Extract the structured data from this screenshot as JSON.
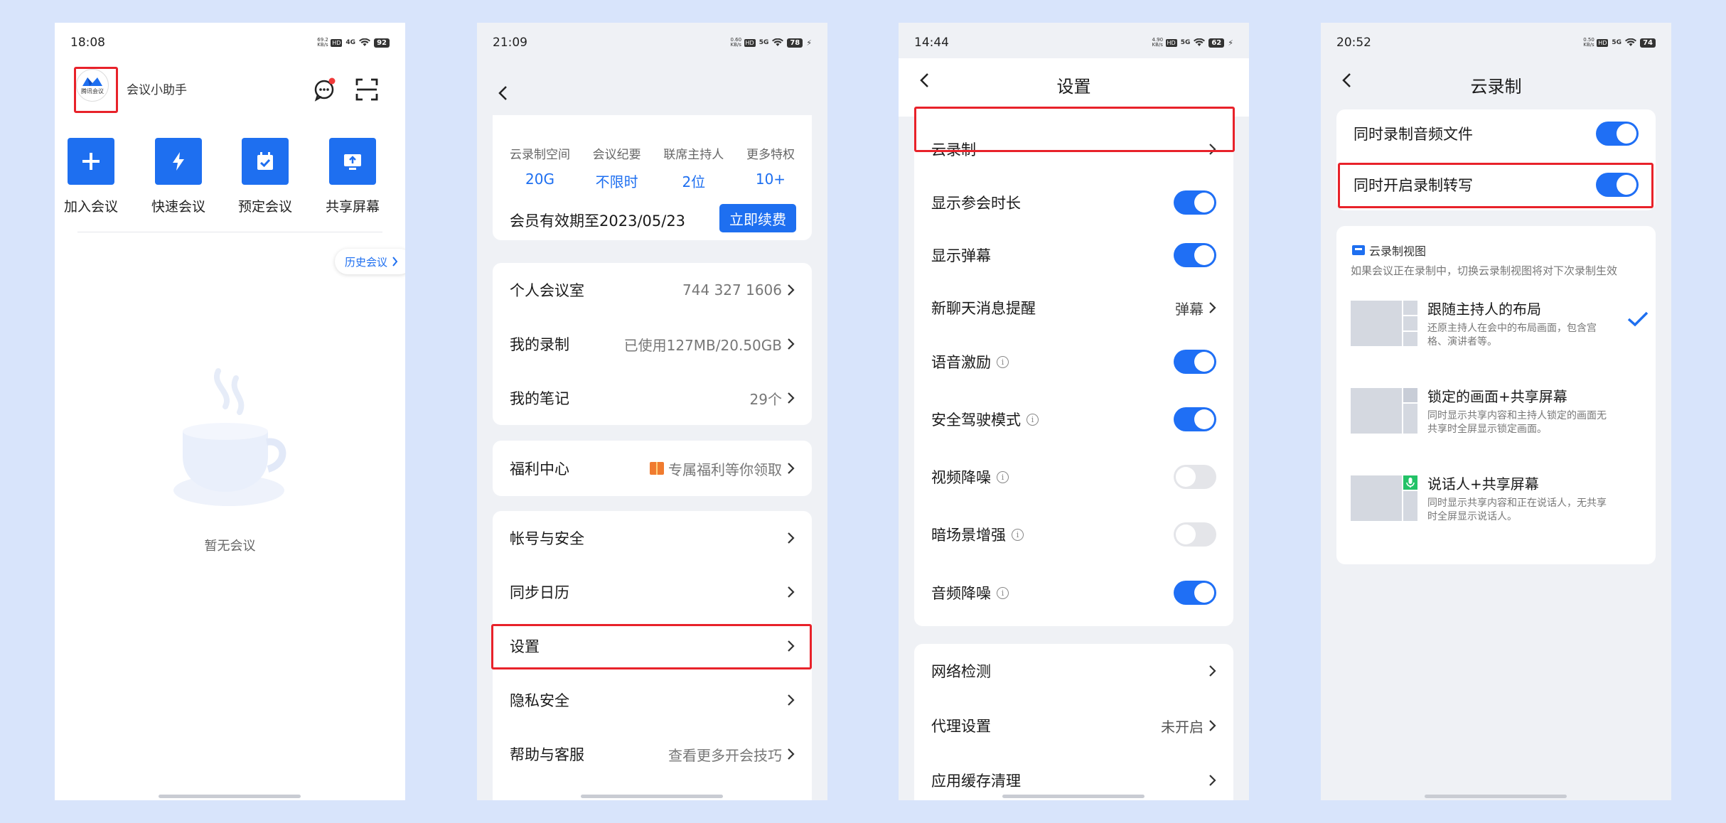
{
  "panel1": {
    "status": {
      "time": "18:08",
      "net_speed": "69.2 KB/s",
      "network": "4G",
      "battery": "92"
    },
    "logo_text": "腾讯会议",
    "assistant": "会议小助手",
    "quick_actions": [
      {
        "label": "加入会议",
        "icon": "plus-icon"
      },
      {
        "label": "快速会议",
        "icon": "lightning-icon"
      },
      {
        "label": "预定会议",
        "icon": "calendar-check-icon"
      },
      {
        "label": "共享屏幕",
        "icon": "screen-share-icon"
      }
    ],
    "history_btn": "历史会议",
    "empty_text": "暂无会议"
  },
  "panel2": {
    "status": {
      "time": "21:09",
      "net_speed": "0.60 KB/s",
      "network": "5G",
      "battery": "78"
    },
    "stats": [
      {
        "label": "云录制空间",
        "value": "20G"
      },
      {
        "label": "会议纪要",
        "value": "不限时"
      },
      {
        "label": "联席主持人",
        "value": "2位"
      },
      {
        "label": "更多特权",
        "value": "10+"
      }
    ],
    "member_text": "会员有效期至2023/05/23",
    "renew_btn": "立即续费",
    "rows_a": [
      {
        "label": "个人会议室",
        "value": "744 327 1606"
      },
      {
        "label": "我的录制",
        "value": "已使用127MB/20.50GB"
      },
      {
        "label": "我的笔记",
        "value": "29个"
      }
    ],
    "benefit": {
      "label": "福利中心",
      "value": "专属福利等你领取"
    },
    "rows_b": [
      {
        "label": "帐号与安全",
        "value": ""
      },
      {
        "label": "同步日历",
        "value": ""
      },
      {
        "label": "设置",
        "value": ""
      },
      {
        "label": "隐私安全",
        "value": ""
      },
      {
        "label": "帮助与客服",
        "value": "查看更多开会技巧"
      }
    ]
  },
  "panel3": {
    "status": {
      "time": "14:44",
      "net_speed": "4.90 KB/s",
      "network": "5G",
      "battery": "62"
    },
    "title": "设置",
    "rows": [
      {
        "label": "云录制",
        "type": "arrow",
        "value": ""
      },
      {
        "label": "显示参会时长",
        "type": "toggle",
        "on": true
      },
      {
        "label": "显示弹幕",
        "type": "toggle",
        "on": true
      },
      {
        "label": "新聊天消息提醒",
        "type": "arrow",
        "value": "弹幕"
      },
      {
        "label": "语音激励",
        "type": "toggle",
        "on": true,
        "info": true
      },
      {
        "label": "安全驾驶模式",
        "type": "toggle",
        "on": true,
        "info": true
      },
      {
        "label": "视频降噪",
        "type": "toggle",
        "on": false,
        "info": true
      },
      {
        "label": "暗场景增强",
        "type": "toggle",
        "on": false,
        "info": true
      },
      {
        "label": "音频降噪",
        "type": "toggle",
        "on": true,
        "info": true
      }
    ],
    "rows_b": [
      {
        "label": "网络检测",
        "value": ""
      },
      {
        "label": "代理设置",
        "value": "未开启"
      },
      {
        "label": "应用缓存清理",
        "value": ""
      }
    ]
  },
  "panel4": {
    "status": {
      "time": "20:52",
      "net_speed": "0.50 KB/s",
      "network": "5G",
      "battery": "74"
    },
    "title": "云录制",
    "toggles": [
      {
        "label": "同时录制音频文件",
        "on": true
      },
      {
        "label": "同时开启录制转写",
        "on": true
      }
    ],
    "section_title": "云录制视图",
    "section_desc": "如果会议正在录制中，切换云录制视图将对下次录制生效",
    "layouts": [
      {
        "title": "跟随主持人的布局",
        "desc": "还原主持人在会中的布局画面，包含宫格、演讲者等。",
        "selected": true
      },
      {
        "title": "锁定的画面+共享屏幕",
        "desc": "同时显示共享内容和主持人锁定的画面无共享时全屏显示锁定画面。",
        "selected": false
      },
      {
        "title": "说话人+共享屏幕",
        "desc": "同时显示共享内容和正在说话人，无共享时全屏显示说话人。",
        "selected": false
      }
    ]
  }
}
